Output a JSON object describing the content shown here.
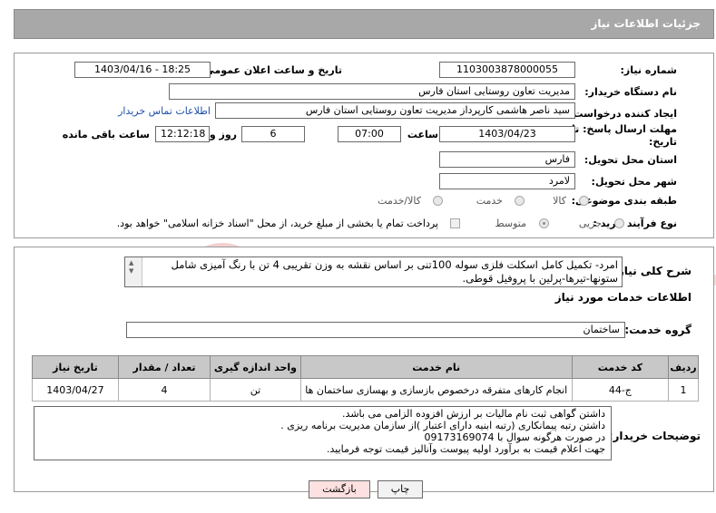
{
  "header": {
    "title": "جزئیات اطلاعات نیاز"
  },
  "form": {
    "need_number_label": "شماره نیاز:",
    "need_number": "1103003878000055",
    "announce_label": "تاریخ و ساعت اعلان عمومی:",
    "announce_value": "1403/04/16 - 18:25",
    "buyer_org_label": "نام دستگاه خریدار:",
    "buyer_org": "مدیریت تعاون روستایی استان فارس",
    "creator_label": "ایجاد کننده درخواست:",
    "creator": "سید ناصر هاشمی کارپرداز مدیریت تعاون روستایی استان فارس",
    "contact_link": "اطلاعات تماس خریدار",
    "deadline_label_1": "مهلت ارسال پاسخ: تا",
    "deadline_label_2": "تاریخ:",
    "deadline_date": "1403/04/23",
    "time_label": "ساعت",
    "deadline_time": "07:00",
    "days_value": "6",
    "days_label": "روز و",
    "remaining_time": "12:12:18",
    "remaining_label": "ساعت باقی مانده",
    "province_label": "استان محل تحویل:",
    "province": "فارس",
    "city_label": "شهر محل تحویل:",
    "city": "لامرد",
    "category_label": "طبقه بندی موضوعی:",
    "category_options": [
      "کالا",
      "خدمت",
      "کالا/خدمت"
    ],
    "purchase_type_label": "نوع فرآیند خرید :",
    "purchase_type_options": [
      "جزیی",
      "متوسط"
    ],
    "payment_note": "پرداخت تمام یا بخشی از مبلغ خرید، از محل \"اسناد خزانه اسلامی\" خواهد بود."
  },
  "summary": {
    "label": "شرح کلی نیاز:",
    "text": "امرد- تکمیل کامل اسکلت فلزی سوله 100تنی بر اساس نقشه به وزن تقریبی 4 تن با رنگ آمیزی شامل ستونها-تیرها-پرلین با پروفیل قوطی."
  },
  "services": {
    "section_title": "اطلاعات خدمات مورد نیاز",
    "group_label": "گروه خدمت:",
    "group_value": "ساختمان",
    "columns": [
      "ردیف",
      "کد خدمت",
      "نام خدمت",
      "واحد اندازه گیری",
      "تعداد / مقدار",
      "تاریخ نیاز"
    ],
    "rows": [
      {
        "index": "1",
        "code": "ج-44",
        "name": "انجام کارهای متفرقه درخصوص بازسازی و بهسازی ساختمان ها",
        "unit": "تن",
        "qty": "4",
        "date": "1403/04/27"
      }
    ]
  },
  "buyer_notes": {
    "label": "توضیحات خریدار:",
    "lines": [
      "داشتن گواهی ثبت نام مالیات بر ارزش افزوده الزامی می باشد.",
      "داشتن رتبه پیمانکاری (رتبه ابنیه دارای اعتبار )از سازمان مدیریت برنامه ریزی .",
      "در صورت هرگونه سوال با 09173169074",
      "جهت اعلام قیمت به برآورد اولیه پیوست وآنالیز قیمت توجه فرمایید."
    ]
  },
  "buttons": {
    "print": "چاپ",
    "back": "بازگشت"
  },
  "watermark": {
    "text": "AriaTender.net"
  },
  "colors": {
    "header_bg": "#a8a8a8",
    "link": "#1f4ea8",
    "back_button_bg": "#fde0e0",
    "watermark": "#f2d0d0"
  }
}
